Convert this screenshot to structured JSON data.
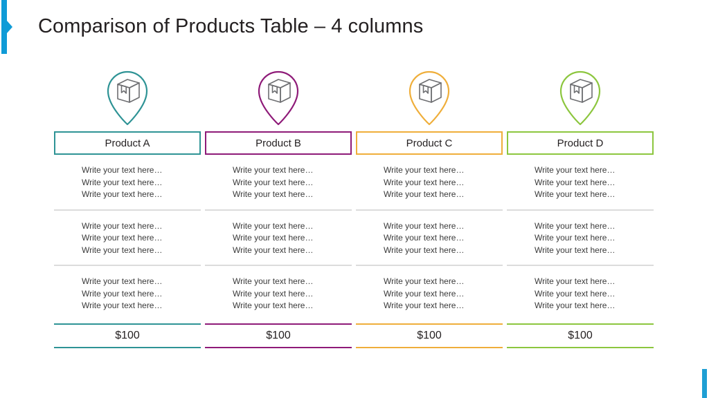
{
  "slide": {
    "title": "Comparison of Products Table – 4 columns",
    "accent_left_color": "#0F9BD7",
    "accent_right_color": "#1F9FD4",
    "divider_color": "#DCDCDC",
    "icon_color": "#6D6E71"
  },
  "columns": [
    {
      "name": "Product A",
      "color": "#2E9395",
      "icon": "package-box-pin-icon",
      "groups": [
        [
          "Write your text here…",
          "Write your text here…",
          "Write your text here…"
        ],
        [
          "Write your text here…",
          "Write your text here…",
          "Write your text here…"
        ],
        [
          "Write your text here…",
          "Write your text here…",
          "Write your text here…"
        ]
      ],
      "price": "$100"
    },
    {
      "name": "Product B",
      "color": "#8E1A78",
      "icon": "package-box-pin-icon",
      "groups": [
        [
          "Write your text here…",
          "Write your text here…",
          "Write your text here…"
        ],
        [
          "Write your text here…",
          "Write your text here…",
          "Write your text here…"
        ],
        [
          "Write your text here…",
          "Write your text here…",
          "Write your text here…"
        ]
      ],
      "price": "$100"
    },
    {
      "name": "Product C",
      "color": "#EFAE3A",
      "icon": "package-box-pin-icon",
      "groups": [
        [
          "Write your text here…",
          "Write your text here…",
          "Write your text here…"
        ],
        [
          "Write your text here…",
          "Write your text here…",
          "Write your text here…"
        ],
        [
          "Write your text here…",
          "Write your text here…",
          "Write your text here…"
        ]
      ],
      "price": "$100"
    },
    {
      "name": "Product D",
      "color": "#8CC63E",
      "icon": "package-box-pin-icon",
      "groups": [
        [
          "Write your text here…",
          "Write your text here…",
          "Write your text here…"
        ],
        [
          "Write your text here…",
          "Write your text here…",
          "Write your text here…"
        ],
        [
          "Write your text here…",
          "Write your text here…",
          "Write your text here…"
        ]
      ],
      "price": "$100"
    }
  ]
}
